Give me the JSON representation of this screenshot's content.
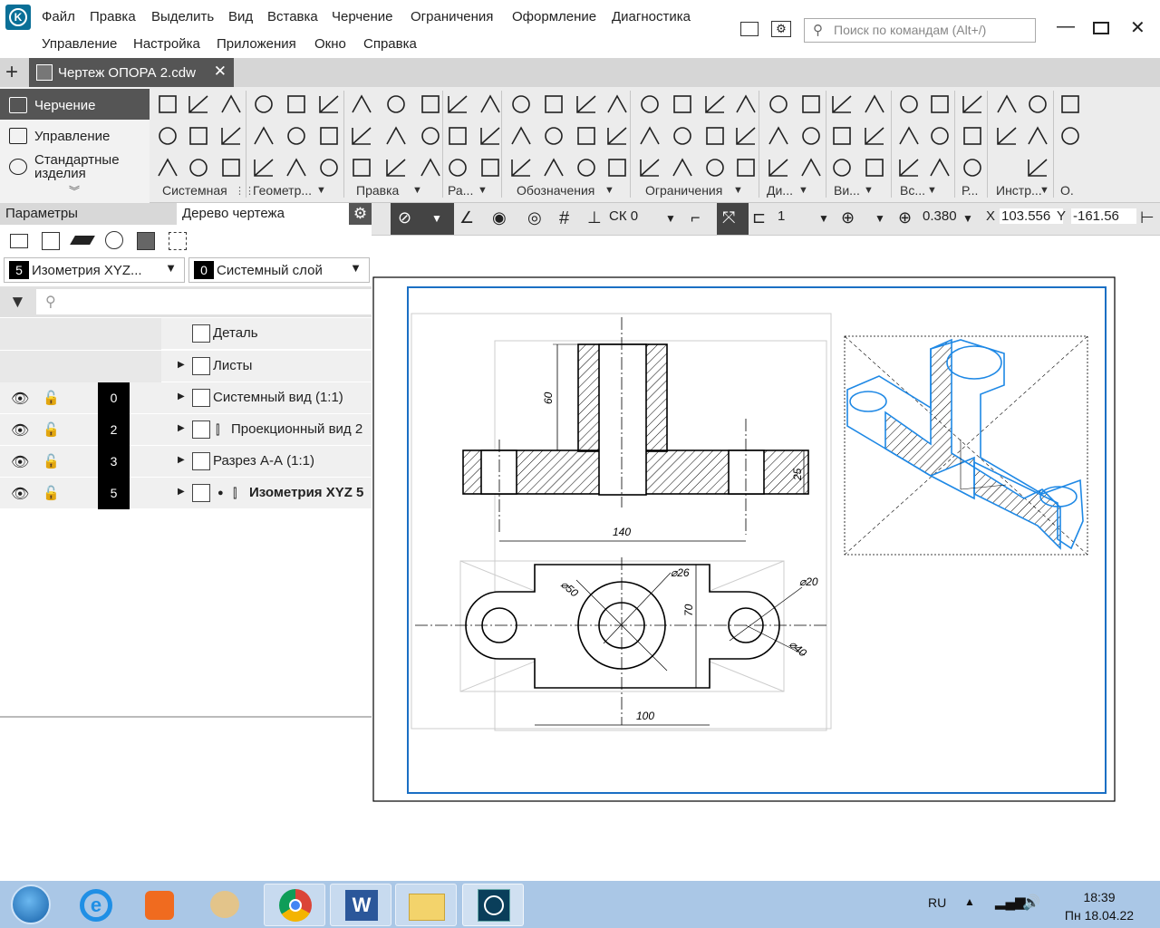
{
  "app": {
    "logo_letter": "K"
  },
  "menu": {
    "row1": [
      "Файл",
      "Правка",
      "Выделить",
      "Вид",
      "Вставка",
      "Черчение",
      "Ограничения",
      "Оформление",
      "Диагностика"
    ],
    "row2": [
      "Управление",
      "Настройка",
      "Приложения",
      "Окно",
      "Справка"
    ]
  },
  "search": {
    "placeholder": "Поиск по командам (Alt+/)"
  },
  "tab": {
    "title": "Чертеж ОПОРА 2.cdw",
    "close": "✕",
    "plus": "+"
  },
  "ribbon_tabs": [
    "Черчение",
    "Управление",
    "Стандартные изделия"
  ],
  "ribbon_groups": [
    "Системная",
    "Геометр...",
    "Правка",
    "Ра...",
    "Обозначения",
    "Ограничения",
    "Ди...",
    "Ви...",
    "Вс...",
    "Р...",
    "Инстр...",
    "О."
  ],
  "panel": {
    "tab_params": "Параметры",
    "tab_tree": "Дерево чертежа",
    "view_select": {
      "num": "5",
      "label": "Изометрия XYZ..."
    },
    "layer_select": {
      "num": "0",
      "label": "Системный слой"
    },
    "search_icon": "⚲"
  },
  "tree": [
    {
      "label": "Деталь"
    },
    {
      "label": "Листы"
    },
    {
      "num": "0",
      "label": "Системный вид (1:1)"
    },
    {
      "num": "2",
      "label": "Проекционный вид 2"
    },
    {
      "num": "3",
      "label": "Разрез А-А (1:1)"
    },
    {
      "num": "5",
      "label": "Изометрия XYZ 5"
    }
  ],
  "drawbar": {
    "cs": "СК 0",
    "style": "1",
    "zoom": "0.380",
    "x_label": "X",
    "x_value": "103.556",
    "y_label": "Y",
    "y_value": "-161.56"
  },
  "drawing": {
    "dim_60": "60",
    "dim_25": "25",
    "dim_140": "140",
    "dim_d26": "⌀26",
    "dim_d50": "⌀50",
    "dim_70": "70",
    "dim_d20": "⌀20",
    "dim_d40": "⌀40",
    "dim_100": "100"
  },
  "taskbar": {
    "lang": "RU",
    "time": "18:39",
    "date": "Пн 18.04.22"
  },
  "colors": {
    "accent": "#1a6fc4",
    "dark": "#555555",
    "iso_blue": "#1e88e5"
  }
}
